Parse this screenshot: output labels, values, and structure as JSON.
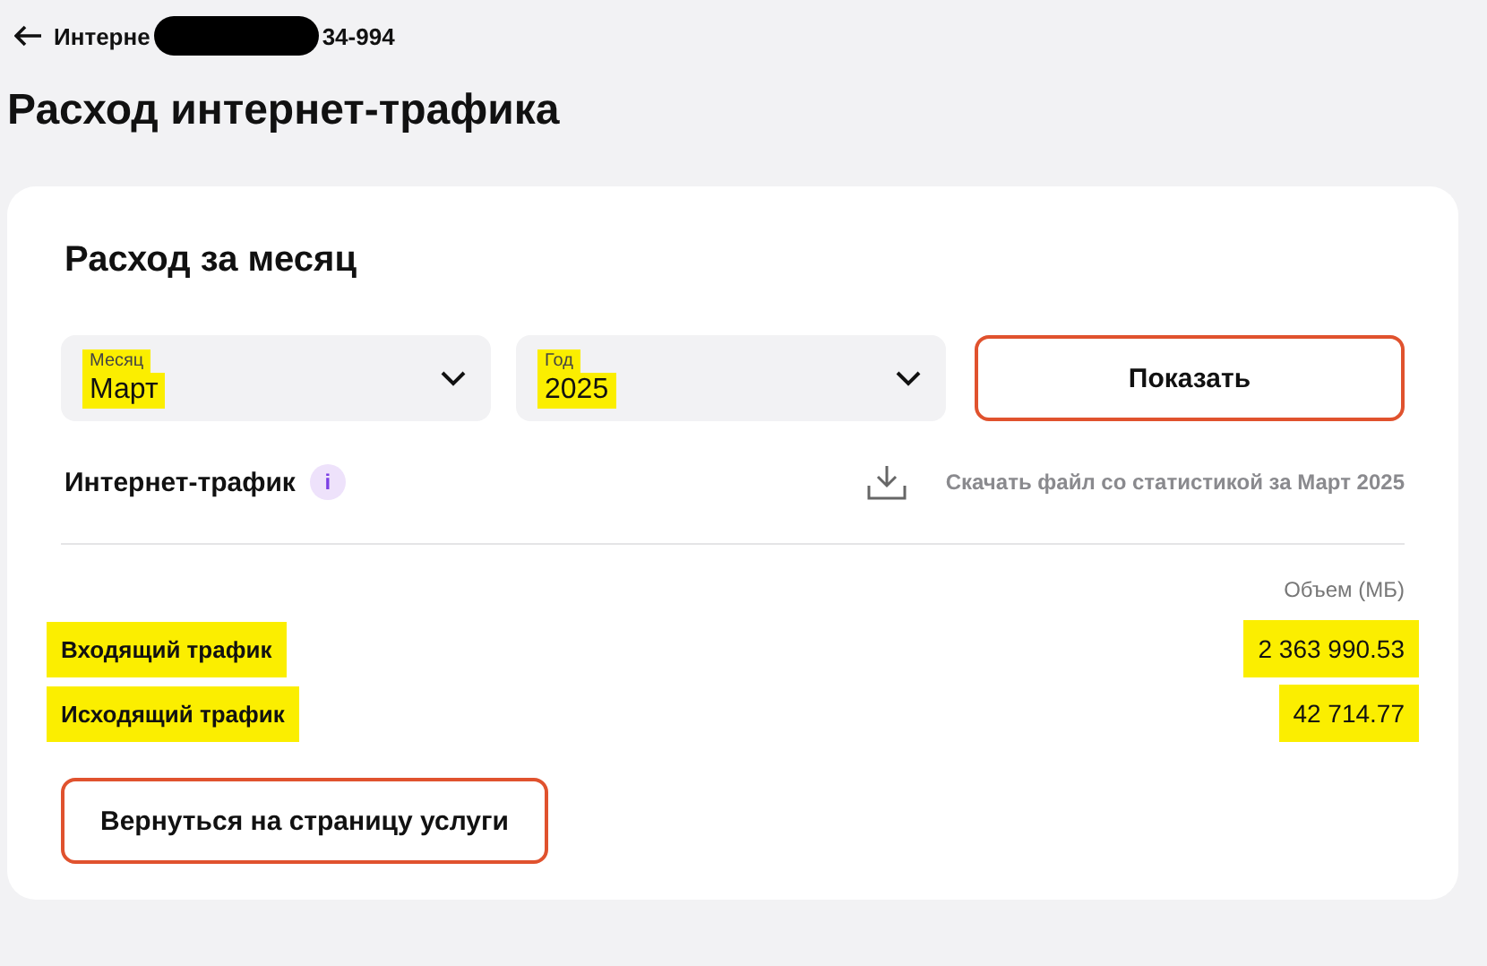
{
  "back_link": {
    "text_before": "Интерне",
    "text_after": "34-994",
    "redacted": true
  },
  "title": "Расход интернет-трафика",
  "card": {
    "heading": "Расход за месяц",
    "selects": [
      {
        "label": "Месяц",
        "value": "Март",
        "highlighted": true
      },
      {
        "label": "Год",
        "value": "2025",
        "highlighted": true
      }
    ],
    "show_button": "Показать",
    "section_title": "Интернет-трафик",
    "info_badge": "i",
    "download_link": "Скачать файл со статистикой за Март 2025",
    "column_header": "Объем (МБ)",
    "rows": [
      {
        "label": "Входящий трафик",
        "value": "2 363 990.53",
        "highlighted": true
      },
      {
        "label": "Исходящий трафик",
        "value": "42 714.77",
        "highlighted": true
      }
    ],
    "back_button": "Вернуться на страницу услуги"
  }
}
